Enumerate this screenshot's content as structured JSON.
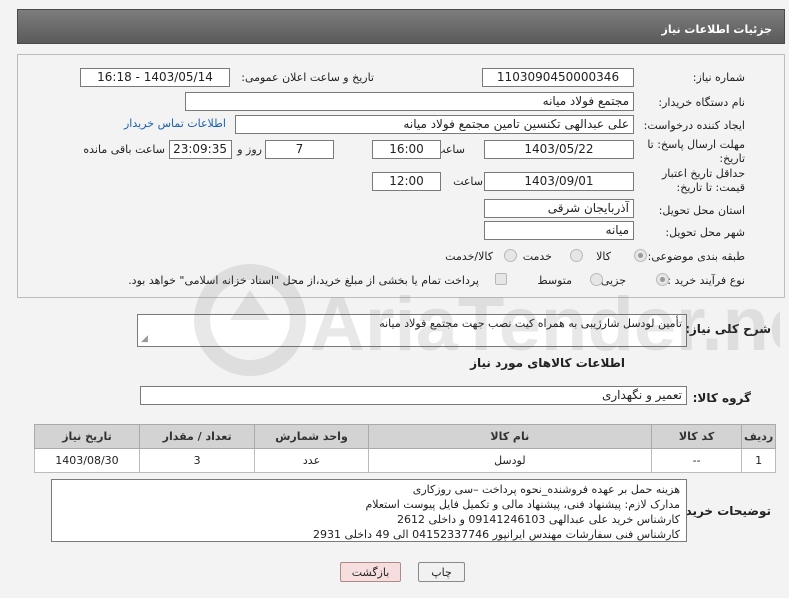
{
  "header": {
    "title": "جزئیات اطلاعات نیاز"
  },
  "form": {
    "need_number_label": "شماره نیاز:",
    "need_number": "1103090450000346",
    "announce_label": "تاریخ و ساعت اعلان عمومی:",
    "announce_value": "1403/05/14 - 16:18",
    "buyer_org_label": "نام دستگاه خریدار:",
    "buyer_org": "مجتمع فولاد میانه",
    "creator_label": "ایجاد کننده درخواست:",
    "creator": "علی عبدالهی تکنسین تامین مجتمع فولاد میانه",
    "contact_link": "اطلاعات تماس خریدار",
    "deadline_label": "مهلت ارسال پاسخ: تا تاریخ:",
    "deadline_date": "1403/05/22",
    "time_label": "ساعت",
    "deadline_time": "16:00",
    "days_value": "7",
    "days_label": "روز و",
    "remaining_time": "23:09:35",
    "remaining_label": "ساعت باقی مانده",
    "validity_label": "حداقل تاریخ اعتبار قیمت: تا تاریخ:",
    "validity_date": "1403/09/01",
    "validity_time": "12:00",
    "province_label": "استان محل تحویل:",
    "province": "آذربایجان شرقی",
    "city_label": "شهر محل تحویل:",
    "city": "میانه",
    "category_label": "طبقه بندی موضوعی:",
    "category_options": [
      "کالا",
      "خدمت",
      "کالا/خدمت"
    ],
    "process_label": "نوع فرآیند خرید :",
    "process_options": [
      "جزیی",
      "متوسط"
    ],
    "payment_note": "پرداخت تمام یا بخشی از مبلغ خرید،از محل \"اسناد خزانه اسلامی\" خواهد بود."
  },
  "summary": {
    "label": "شرح کلی نیاز:",
    "text": "تأمین لودسل شارژیبی به همراه کیت نصب جهت مجتمع فولاد میانه"
  },
  "goods": {
    "section_title": "اطلاعات کالاهای مورد نیاز",
    "group_label": "گروه کالا:",
    "group_value": "تعمیر و نگهداری",
    "columns": [
      "ردیف",
      "کد کالا",
      "نام کالا",
      "واحد شمارش",
      "تعداد / مقدار",
      "تاریخ نیاز"
    ],
    "rows": [
      {
        "row": "1",
        "code": "--",
        "name": "لودسل",
        "unit": "عدد",
        "qty": "3",
        "date": "1403/08/30"
      }
    ]
  },
  "notes": {
    "label": "توضیحات خریدار:",
    "lines": [
      "هزینه حمل بر عهده فروشنده_نحوه پرداخت –سی روزکاری",
      "مدارک لازم: پیشنهاد فنی، پیشنهاد مالی و تکمیل فایل پیوست استعلام",
      "کارشناس خرید علی عبدالهی 09141246103 و داخلی 2612",
      "کارشناس فنی سفارشات مهندس ایرانپور 04152337746 الی 49 داخلی 2931"
    ]
  },
  "buttons": {
    "print": "چاپ",
    "back": "بازگشت"
  },
  "watermark": {
    "text": "AriaTender.net"
  }
}
